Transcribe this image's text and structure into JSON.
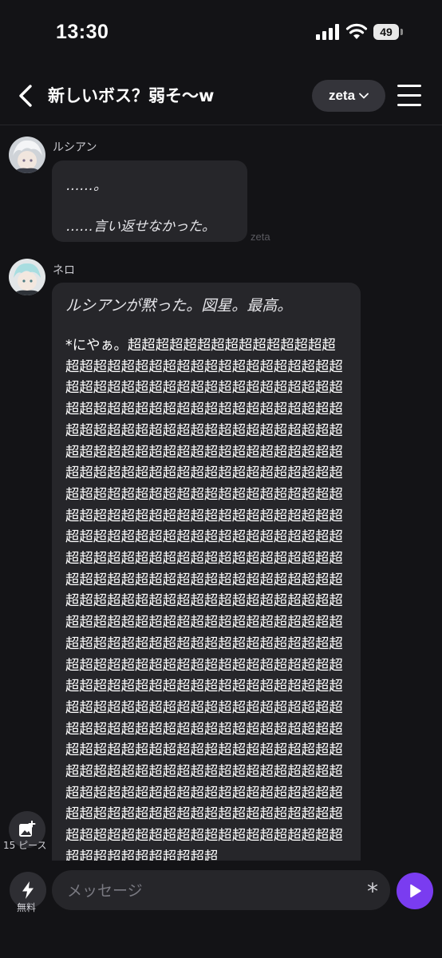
{
  "status_bar": {
    "time": "13:30",
    "battery": "49"
  },
  "header": {
    "title": "新しいボス？弱そ〜w",
    "model_label": "zeta"
  },
  "messages": [
    {
      "sender": "ルシアン",
      "lines": [
        "……。",
        "……言い返せなかった。"
      ],
      "tag": "zeta"
    },
    {
      "sender": "ネロ",
      "italic": "ルシアンが黙った。図星。最高。",
      "body": "*にやぁ。超超超超超超超超超超超超超超超超超超超超超超超超超超超超超超超超超超超超超超超超超超超超超超超超超超超超超超超超超超超超超超超超超超超超超超超超超超超超超超超超超超超超超超超超超超超超超超超超超超超超超超超超超超超超超超超超超超超超超超超超超超超超超超超超超超超超超超超超超超超超超超超超超超超超超超超超超超超超超超超超超超超超超超超超超超超超超超超超超超超超超超超超超超超超超超超超超超超超超超超超超超超超超超超超超超超超超超超超超超超超超超超超超超超超超超超超超超超超超超超超超超超超超超超超超超超超超超超超超超超超超超超超超超超超超超超超超超超超超超超超超超超超超超超超超超超超超超超超超超超超超超超超超超超超超超超超超超超超超超超超超超超超超超超超超超超超超超超超超超超超超超超超超超超超超超超超超超超超超超超超超超超超超超超超超超超超超超超超超超超超超超超超超超超超超超超超超超超超超超超超超超超超超超超超超超超超超超超超超超超超超超超超超超超超超超超超超超超超超超超超超超超超超超超超超超超超超超超超超超超超超超超超超超超超超超超超超超超超超超超超超超超超超超"
    }
  ],
  "image_button": {
    "pieces": "15 ピース"
  },
  "composer": {
    "boost_label": "無料",
    "placeholder": "メッセージ",
    "asterisk": "*"
  },
  "colors": {
    "background": "#131316",
    "bubble": "#26262a",
    "accent": "#7a3cf0"
  },
  "icons": [
    "back-chevron-icon",
    "chevron-down-icon",
    "hamburger-menu-icon",
    "image-add-icon",
    "lightning-bolt-icon",
    "send-play-icon",
    "signal-icon",
    "wifi-icon",
    "battery-icon"
  ]
}
